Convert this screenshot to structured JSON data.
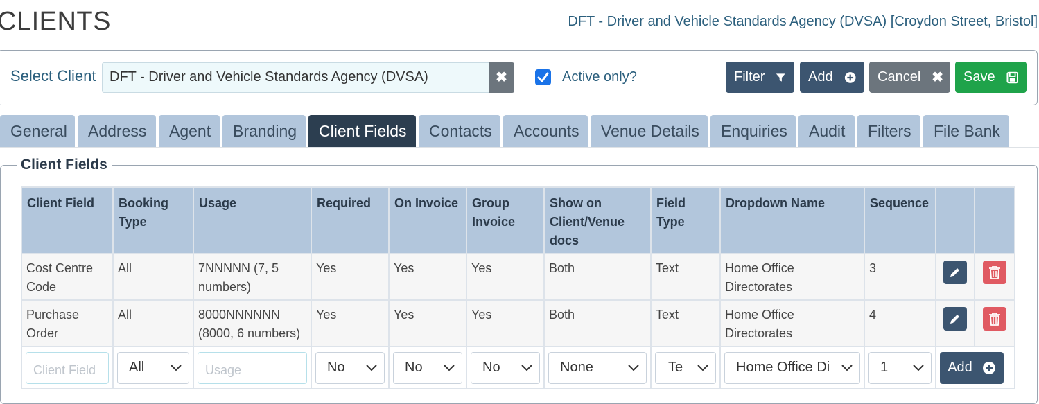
{
  "header": {
    "title": "CLIENTS",
    "client_heading": "DFT - Driver and Vehicle Standards Agency (DVSA) [Croydon Street, Bristol]"
  },
  "client_bar": {
    "select_label": "Select Client",
    "selected_client": "DFT - Driver and Vehicle Standards Agency (DVSA)",
    "active_only_label": "Active only?",
    "active_only_checked": true,
    "buttons": {
      "filter": "Filter",
      "add": "Add",
      "cancel": "Cancel",
      "save": "Save"
    }
  },
  "tabs": [
    {
      "label": "General"
    },
    {
      "label": "Address"
    },
    {
      "label": "Agent"
    },
    {
      "label": "Branding"
    },
    {
      "label": "Client Fields",
      "active": true
    },
    {
      "label": "Contacts"
    },
    {
      "label": "Accounts"
    },
    {
      "label": "Venue Details"
    },
    {
      "label": "Enquiries"
    },
    {
      "label": "Audit"
    },
    {
      "label": "Filters"
    },
    {
      "label": "File Bank"
    }
  ],
  "section": {
    "legend": "Client Fields",
    "columns": [
      "Client Field",
      "Booking Type",
      "Usage",
      "Required",
      "On Invoice",
      "Group Invoice",
      "Show on Client/Venue docs",
      "Field Type",
      "Dropdown Name",
      "Sequence"
    ],
    "rows": [
      {
        "client_field": "Cost Centre Code",
        "booking_type": "All",
        "usage": "7NNNNN (7, 5 numbers)",
        "required": "Yes",
        "on_invoice": "Yes",
        "group_invoice": "Yes",
        "show_on_docs": "Both",
        "field_type": "Text",
        "dropdown_name": "Home Office Directorates",
        "sequence": "3"
      },
      {
        "client_field": "Purchase Order",
        "booking_type": "All",
        "usage": "8000NNNNNN (8000, 6 numbers)",
        "required": "Yes",
        "on_invoice": "Yes",
        "group_invoice": "Yes",
        "show_on_docs": "Both",
        "field_type": "Text",
        "dropdown_name": "Home Office Directorates",
        "sequence": "4"
      }
    ],
    "new_row": {
      "client_field_placeholder": "Client Field",
      "booking_type": "All",
      "usage_placeholder": "Usage",
      "required": "No",
      "on_invoice": "No",
      "group_invoice": "No",
      "show_on_docs": "None",
      "field_type": "Text",
      "dropdown_name": "Home Office Directorates",
      "sequence": "1",
      "add_label": "Add"
    }
  },
  "colors": {
    "primary_dark": "#3c5570",
    "tab_bg": "#b2c6dc",
    "tab_active": "#2c3e50",
    "save_green": "#1fa34a",
    "delete_red": "#e05a62",
    "cancel_gray": "#6c757d",
    "heading_blue": "#2b5f7d"
  }
}
